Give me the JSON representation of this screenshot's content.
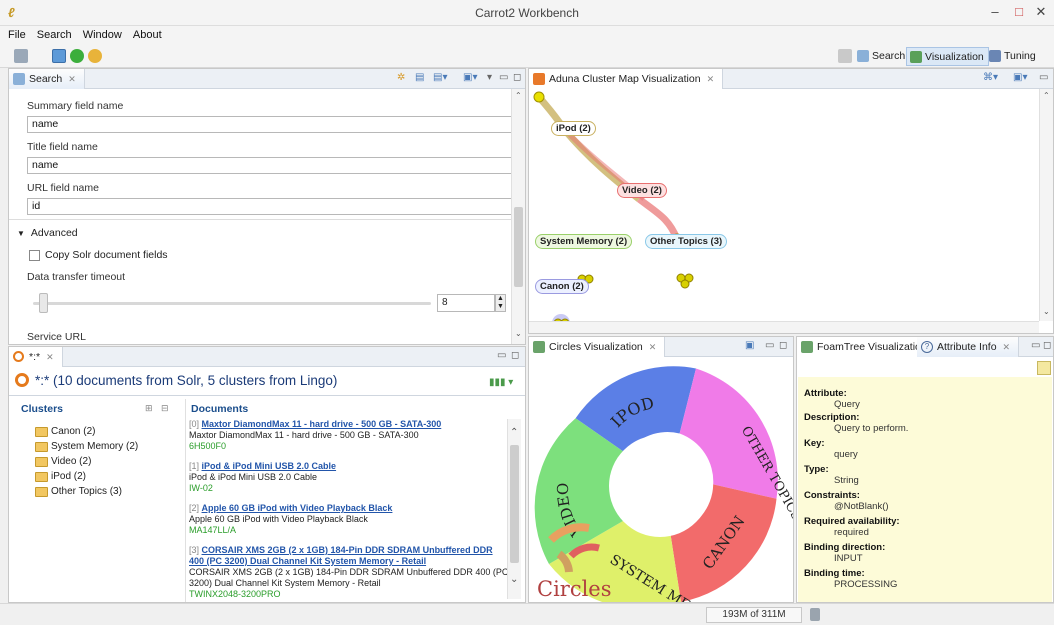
{
  "window": {
    "title": "Carrot2 Workbench",
    "minimize": "–",
    "maximize": "□",
    "close": "✕"
  },
  "menu": [
    "File",
    "Search",
    "Window",
    "About"
  ],
  "perspectives": [
    {
      "label": "Search",
      "active": false
    },
    {
      "label": "Visualization",
      "active": true
    },
    {
      "label": "Tuning",
      "active": false
    }
  ],
  "search_panel": {
    "tab": "Search",
    "summary_label": "Summary field name",
    "summary_value": "name",
    "title_label": "Title field name",
    "title_value": "name",
    "url_label": "URL field name",
    "url_value": "id",
    "advanced_label": "Advanced",
    "copy_fields_label": "Copy Solr document fields",
    "timeout_label": "Data transfer timeout",
    "timeout_value": "8",
    "service_url_label": "Service URL"
  },
  "results_panel": {
    "tab": "*:*",
    "heading": "*:* (10 documents from Solr, 5 clusters from Lingo)",
    "clusters_header": "Clusters",
    "documents_header": "Documents",
    "clusters": [
      "Canon (2)",
      "System Memory (2)",
      "Video (2)",
      "iPod (2)",
      "Other Topics (3)"
    ],
    "documents": [
      {
        "num": "[0]",
        "title": "Maxtor DiamondMax 11 - hard drive - 500 GB - SATA-300",
        "snippet": "Maxtor DiamondMax 11 - hard drive - 500 GB - SATA-300",
        "url": "6H500F0"
      },
      {
        "num": "[1]",
        "title": "iPod & iPod Mini USB 2.0 Cable",
        "snippet": "iPod & iPod Mini USB 2.0 Cable",
        "url": "IW-02"
      },
      {
        "num": "[2]",
        "title": "Apple 60 GB iPod with Video Playback Black",
        "snippet": "Apple 60 GB iPod with Video Playback Black",
        "url": "MA147LL/A"
      },
      {
        "num": "[3]",
        "title": "CORSAIR XMS 2GB (2 x 1GB) 184-Pin DDR SDRAM Unbuffered DDR 400 (PC 3200) Dual Channel Kit System Memory - Retail",
        "snippet": "CORSAIR XMS 2GB (2 x 1GB) 184-Pin DDR SDRAM Unbuffered DDR 400 (PC 3200) Dual Channel Kit System Memory - Retail",
        "url": "TWINX2048-3200PRO"
      }
    ]
  },
  "aduna_panel": {
    "tab": "Aduna Cluster Map Visualization",
    "nodes": [
      "iPod (2)",
      "Video (2)",
      "System Memory (2)",
      "Other Topics (3)",
      "Canon (2)"
    ]
  },
  "circles_panel": {
    "tab": "Circles Visualization",
    "segments": [
      {
        "label": "IPOD",
        "color": "#5b7fe6"
      },
      {
        "label": "OTHER TOPICS",
        "color": "#f07be8"
      },
      {
        "label": "CANON",
        "color": "#f26b6b"
      },
      {
        "label": "SYSTEM MEMORY",
        "color": "#dff06a"
      },
      {
        "label": "VIDEO",
        "color": "#7de07d"
      }
    ],
    "logo": "Circles"
  },
  "foam_panel": {
    "tab_foam": "FoamTree Visualization",
    "tab_attr": "Attribute Info",
    "attributes": [
      {
        "key": "Attribute:",
        "value": "Query"
      },
      {
        "key": "Description:",
        "value": "Query to perform."
      },
      {
        "key": "Key:",
        "value": "query"
      },
      {
        "key": "Type:",
        "value": "String"
      },
      {
        "key": "Constraints:",
        "value": "@NotBlank()"
      },
      {
        "key": "Required availability:",
        "value": "required"
      },
      {
        "key": "Binding direction:",
        "value": "INPUT"
      },
      {
        "key": "Binding time:",
        "value": "PROCESSING"
      }
    ]
  },
  "status": {
    "memory": "193M of 311M"
  }
}
